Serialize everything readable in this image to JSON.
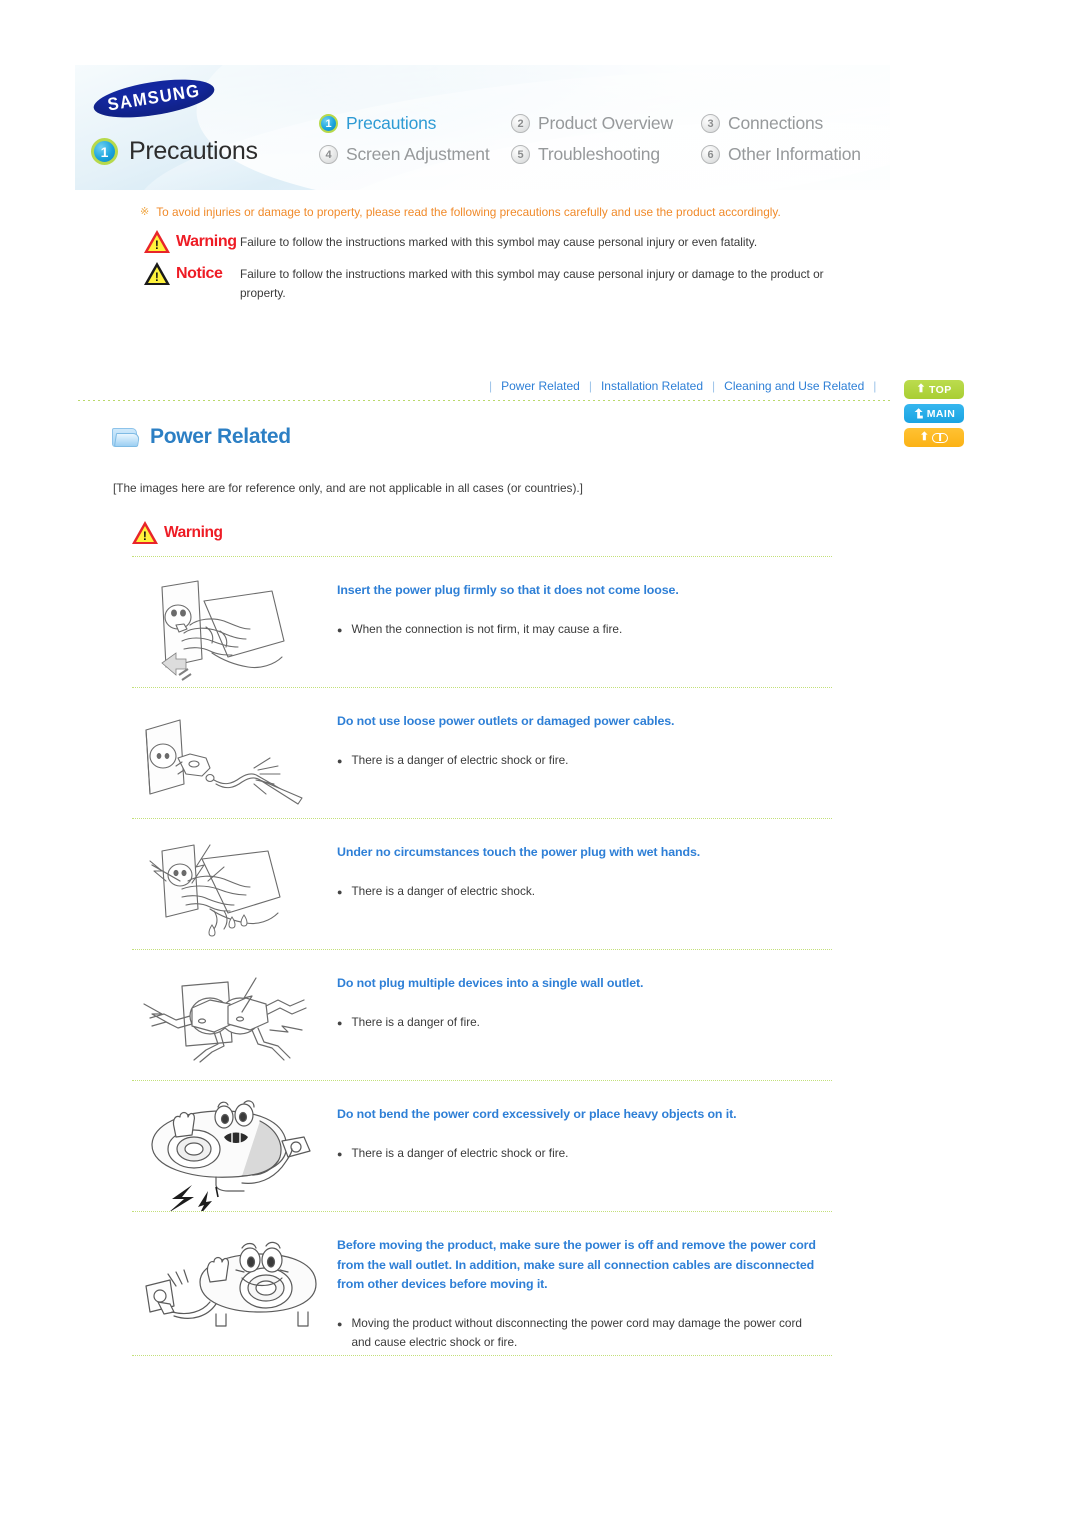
{
  "brand": {
    "logo_text": "SAMSUNG"
  },
  "header": {
    "chapter_number": "1",
    "chapter_label": "Precautions",
    "nav_items": [
      {
        "num": "1",
        "label": "Precautions",
        "active": true
      },
      {
        "num": "2",
        "label": "Product Overview",
        "active": false
      },
      {
        "num": "3",
        "label": "Connections",
        "active": false
      },
      {
        "num": "4",
        "label": "Screen Adjustment",
        "active": false
      },
      {
        "num": "5",
        "label": "Troubleshooting",
        "active": false
      },
      {
        "num": "6",
        "label": "Other Information",
        "active": false
      }
    ]
  },
  "intro": {
    "star_glyph": "※",
    "lead": "To avoid injuries or damage to property, please read the following precautions carefully and use the product accordingly.",
    "symbols": [
      {
        "badge_label": "Warning",
        "badge_color": "#ee1c25",
        "triangle_color": "#e8252a",
        "text": "Failure to follow the instructions marked with this symbol may cause personal injury or even fatality."
      },
      {
        "badge_label": "Notice",
        "badge_color": "#ee1c25",
        "triangle_color": "#1a1a1a",
        "text": "Failure to follow the instructions marked with this symbol may cause personal injury or damage to the product or property."
      }
    ]
  },
  "subnav": {
    "separator": "|",
    "links": [
      "Power Related",
      "Installation Related",
      "Cleaning and Use Related"
    ]
  },
  "side_buttons": [
    {
      "name": "top",
      "label": "TOP",
      "color": "#aacf34",
      "icon": "up-arrow-icon"
    },
    {
      "name": "main",
      "label": "MAIN",
      "color": "#1aa3e2",
      "icon": "turn-arrow-icon"
    },
    {
      "name": "list",
      "label": "",
      "color": "#fbb215",
      "icon": "book-icon"
    }
  ],
  "section": {
    "icon": "folder-icon",
    "title": "Power Related",
    "title_color": "#2c7fc4",
    "reference_note": "[The images here are for reference only, and are not applicable in all cases (or countries).]",
    "warning_badge": "Warning"
  },
  "safety_items": [
    {
      "illustration": "hand-inserting-plug-into-outlet",
      "heading": "Insert the power plug firmly so that it does not come loose.",
      "bullets": [
        "When the connection is not firm, it may cause a fire."
      ]
    },
    {
      "illustration": "damaged-frayed-power-cable-in-outlet",
      "heading": "Do not use loose power outlets or damaged power cables.",
      "bullets": [
        "There is a danger of electric shock or fire."
      ]
    },
    {
      "illustration": "wet-hand-touching-plug-with-shock-bolts",
      "heading": "Under no circumstances touch the power plug with wet hands.",
      "bullets": [
        "There is a danger of electric shock."
      ]
    },
    {
      "illustration": "multiple-plugs-in-single-outlet-with-bolts",
      "heading": "Do not plug multiple devices into a single wall outlet.",
      "bullets": [
        "There is a danger of fire."
      ]
    },
    {
      "illustration": "projector-character-with-bent-cord",
      "heading": "Do not bend the power cord excessively or place heavy objects on it.",
      "bullets": [
        "There is a danger of electric shock or fire."
      ]
    },
    {
      "illustration": "projector-character-unplugging-cord",
      "heading": "Before moving the product, make sure the power is off and remove the power cord from the wall outlet. In addition, make sure all connection cables are disconnected from other devices before moving it.",
      "bullets": [
        "Moving the product without disconnecting the power cord may damage the power cord and cause electric shock or fire."
      ]
    }
  ]
}
